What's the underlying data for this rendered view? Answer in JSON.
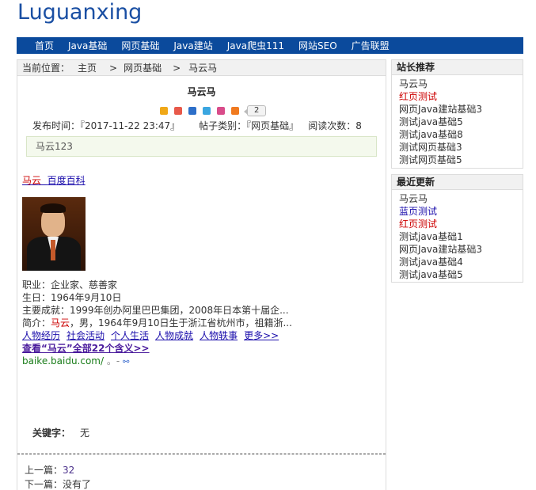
{
  "site": {
    "title": "Luguanxing"
  },
  "nav": {
    "items": [
      "首页",
      "Java基础",
      "网页基础",
      "Java建站",
      "Java爬虫111",
      "网站SEO",
      "广告联盟"
    ]
  },
  "breadcrumb": {
    "prefix": "当前位置：",
    "home": "主页",
    "sep": ">",
    "category": "网页基础",
    "current": "马云马"
  },
  "article": {
    "title": "马云马",
    "share_count": "2",
    "publish_label": "发布时间：",
    "publish_value": "『2017-11-22 23:47』",
    "category_label": "帖子类别：",
    "category_value": "『网页基础』",
    "reads_label": "阅读次数：",
    "reads_value": "8",
    "summary": "马云123",
    "baike_name": "马云",
    "baike_link": "百度百科",
    "occupation": "职业：企业家、慈善家",
    "birthday": "生日：1964年9月10日",
    "achievement": "主要成就：1999年创办阿里巴巴集团，2008年日本第十届企...",
    "intro_prefix": "简介：",
    "intro_name": "马云",
    "intro_rest": "，男，1964年9月10日生于浙江省杭州市，祖籍浙...",
    "links": [
      "人物经历",
      "社会活动",
      "个人生活",
      "人物成就",
      "人物轶事",
      "更多>>"
    ],
    "see_all": "查看“马云”全部22个含义>>",
    "source": "baike.baidu.com/",
    "source_suffix": " 。- ",
    "keywords_label": "关键字：",
    "keywords_value": "无",
    "prev_label": "上一篇：",
    "prev_value": "32",
    "next_label": "下一篇：",
    "next_value": "没有了"
  },
  "sidebar": {
    "recommend": {
      "title": "站长推荐",
      "items": [
        "马云马",
        "红页测试",
        "网页Java建站基础3",
        "测试java基础5",
        "测试java基础8",
        "测试网页基础3",
        "测试网页基础5"
      ]
    },
    "latest": {
      "title": "最近更新",
      "items": [
        "马云马",
        "蓝页测试",
        "红页测试",
        "测试java基础1",
        "网页Java建站基础3",
        "测试java基础4",
        "测试java基础5"
      ]
    }
  },
  "colors": {
    "nav_bg": "#0b4a9c",
    "title": "#1a4fa3",
    "red_link": "#cc0000",
    "blue_link": "#1a0dab"
  }
}
